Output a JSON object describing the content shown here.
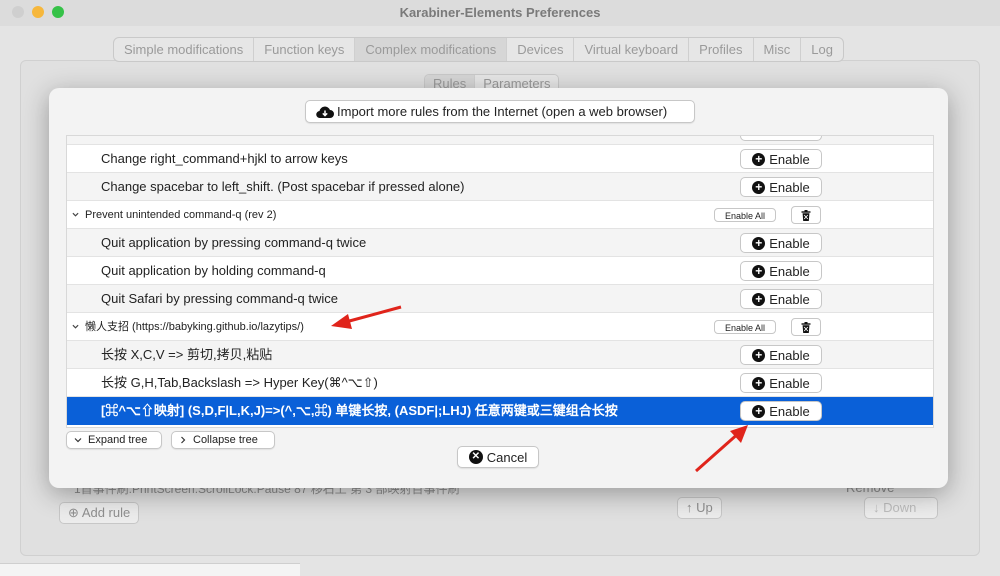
{
  "window": {
    "title": "Karabiner-Elements Preferences"
  },
  "tabs": [
    {
      "label": "Simple modifications",
      "active": false
    },
    {
      "label": "Function keys",
      "active": false
    },
    {
      "label": "Complex modifications",
      "active": true
    },
    {
      "label": "Devices",
      "active": false
    },
    {
      "label": "Virtual keyboard",
      "active": false
    },
    {
      "label": "Profiles",
      "active": false
    },
    {
      "label": "Misc",
      "active": false
    },
    {
      "label": "Log",
      "active": false
    }
  ],
  "subtabs": [
    {
      "label": "Rules",
      "active": true
    },
    {
      "label": "Parameters",
      "active": false
    }
  ],
  "background": {
    "partial_rule_text": "1首事件刷:PrintScreen:ScrollLock:Pause    87 移石上 第 3 部映射百事件刷",
    "remove_label": "Remove",
    "add_rule_label": "Add rule",
    "up_label": "Up",
    "down_label": "Down"
  },
  "dialog": {
    "import_button": "Import more rules from the Internet (open a web browser)",
    "rows": [
      {
        "type": "item",
        "label": "Change right_command+hjkl to arrow keys",
        "button": "Enable"
      },
      {
        "type": "item",
        "label": "Change spacebar to left_shift. (Post spacebar if pressed alone)",
        "button": "Enable"
      },
      {
        "type": "group",
        "label": "Prevent unintended command-q (rev 2)",
        "button": "Enable All"
      },
      {
        "type": "item",
        "label": "Quit application by pressing command-q twice",
        "button": "Enable"
      },
      {
        "type": "item",
        "label": "Quit application by holding command-q",
        "button": "Enable"
      },
      {
        "type": "item",
        "label": "Quit Safari by pressing command-q twice",
        "button": "Enable"
      },
      {
        "type": "group",
        "label": "懒人支招 (https://babyking.github.io/lazytips/)",
        "button": "Enable All"
      },
      {
        "type": "item",
        "label": "长按 X,C,V => 剪切,拷贝,粘贴",
        "button": "Enable"
      },
      {
        "type": "item",
        "label": "长按 G,H,Tab,Backslash => Hyper Key(⌘^⌥⇧)",
        "button": "Enable"
      },
      {
        "type": "item",
        "label": "[⌘^⌥⇧映射] (S,D,F|L,K,J)=>(^,⌥,⌘) 单键长按, (ASDF|;LHJ) 任意两键或三键组合长按",
        "button": "Enable",
        "selected": true
      }
    ],
    "expand_tree": "Expand tree",
    "collapse_tree": "Collapse tree",
    "cancel": "Cancel"
  },
  "colors": {
    "selection": "#0a60d8",
    "annotation_arrow": "#e0241b",
    "traffic_yellow": "#f6b73c",
    "traffic_green": "#36c248"
  },
  "icons": [
    "cloud-download-icon",
    "plus-circle-icon",
    "trash-icon",
    "chevron-down-icon",
    "chevron-right-icon",
    "x-circle-icon",
    "arrow-up-icon",
    "arrow-down-icon"
  ]
}
